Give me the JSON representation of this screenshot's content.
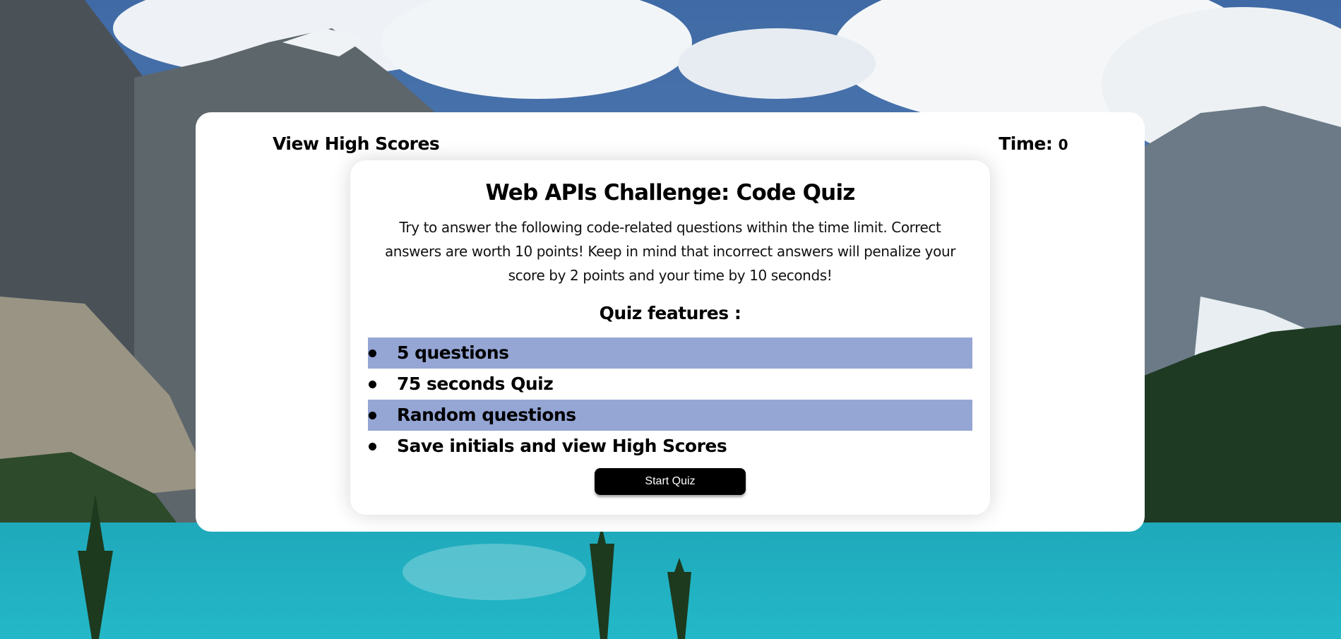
{
  "header": {
    "view_high_scores_label": "View High Scores",
    "timer_label": "Time:",
    "timer_value": "0"
  },
  "quiz": {
    "title": "Web APIs Challenge: Code Quiz",
    "description": "Try to answer the following code-related questions within the time limit. Correct answers are worth 10 points! Keep in mind that incorrect answers will penalize your score by 2 points and your time by 10 seconds!",
    "features_heading": "Quiz features :",
    "features": [
      "5 questions",
      "75 seconds Quiz",
      "Random questions",
      "Save initials and view High Scores"
    ],
    "start_button_label": "Start Quiz"
  },
  "colors": {
    "highlight": "#95a5d4",
    "button_bg": "#000000",
    "button_text": "#ffffff",
    "card_bg": "#ffffff"
  }
}
